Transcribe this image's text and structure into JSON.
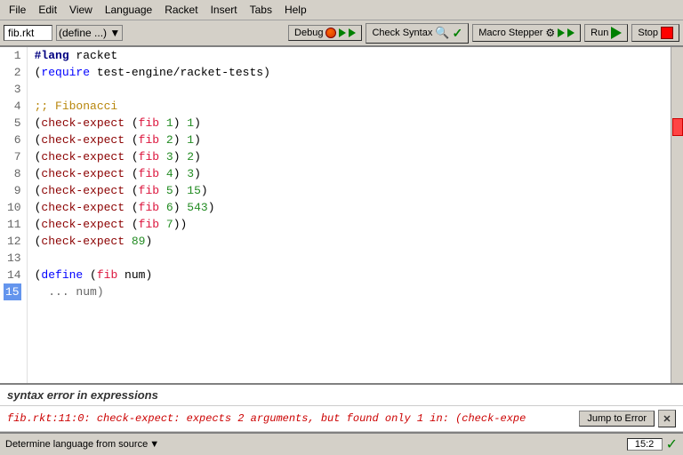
{
  "menubar": {
    "items": [
      "File",
      "Edit",
      "View",
      "Language",
      "Racket",
      "Insert",
      "Tabs",
      "Help"
    ]
  },
  "toolbar": {
    "filename": "fib.rkt",
    "dropdown_label": "(define ...) ▼",
    "debug_label": "Debug",
    "check_syntax_label": "Check Syntax",
    "macro_stepper_label": "Macro Stepper",
    "run_label": "Run",
    "stop_label": "Stop"
  },
  "editor": {
    "lines": [
      {
        "num": 1,
        "current": false,
        "tokens": [
          {
            "text": "#lang",
            "cls": "kw"
          },
          {
            "text": " racket",
            "cls": ""
          }
        ]
      },
      {
        "num": 2,
        "current": false,
        "tokens": [
          {
            "text": "(",
            "cls": "paren"
          },
          {
            "text": "require",
            "cls": "kw2"
          },
          {
            "text": " test-engine/racket-tests",
            "cls": ""
          },
          {
            "text": ")",
            "cls": "paren"
          }
        ]
      },
      {
        "num": 3,
        "current": false,
        "tokens": []
      },
      {
        "num": 4,
        "current": false,
        "tokens": [
          {
            "text": ";; Fibonacci",
            "cls": "comment"
          }
        ]
      },
      {
        "num": 5,
        "current": false,
        "tokens": [
          {
            "text": "(",
            "cls": ""
          },
          {
            "text": "check-expect",
            "cls": "fn"
          },
          {
            "text": " (",
            "cls": ""
          },
          {
            "text": "fib",
            "cls": "fn2"
          },
          {
            "text": " ",
            "cls": ""
          },
          {
            "text": "1",
            "cls": "num"
          },
          {
            "text": ") ",
            "cls": ""
          },
          {
            "text": "1",
            "cls": "num"
          },
          {
            "text": ")",
            "cls": ""
          }
        ]
      },
      {
        "num": 6,
        "current": false,
        "tokens": [
          {
            "text": "(",
            "cls": ""
          },
          {
            "text": "check-expect",
            "cls": "fn"
          },
          {
            "text": " (",
            "cls": ""
          },
          {
            "text": "fib",
            "cls": "fn2"
          },
          {
            "text": " ",
            "cls": ""
          },
          {
            "text": "2",
            "cls": "num"
          },
          {
            "text": ") ",
            "cls": ""
          },
          {
            "text": "1",
            "cls": "num"
          },
          {
            "text": ")",
            "cls": ""
          }
        ]
      },
      {
        "num": 7,
        "current": false,
        "tokens": [
          {
            "text": "(",
            "cls": ""
          },
          {
            "text": "check-expect",
            "cls": "fn"
          },
          {
            "text": " (",
            "cls": ""
          },
          {
            "text": "fib",
            "cls": "fn2"
          },
          {
            "text": " ",
            "cls": ""
          },
          {
            "text": "3",
            "cls": "num"
          },
          {
            "text": ") ",
            "cls": ""
          },
          {
            "text": "2",
            "cls": "num"
          },
          {
            "text": ")",
            "cls": ""
          }
        ]
      },
      {
        "num": 8,
        "current": false,
        "tokens": [
          {
            "text": "(",
            "cls": ""
          },
          {
            "text": "check-expect",
            "cls": "fn"
          },
          {
            "text": " (",
            "cls": ""
          },
          {
            "text": "fib",
            "cls": "fn2"
          },
          {
            "text": " ",
            "cls": ""
          },
          {
            "text": "4",
            "cls": "num"
          },
          {
            "text": ") ",
            "cls": ""
          },
          {
            "text": "3",
            "cls": "num"
          },
          {
            "text": ")",
            "cls": ""
          }
        ]
      },
      {
        "num": 9,
        "current": false,
        "tokens": [
          {
            "text": "(",
            "cls": ""
          },
          {
            "text": "check-expect",
            "cls": "fn"
          },
          {
            "text": " (",
            "cls": ""
          },
          {
            "text": "fib",
            "cls": "fn2"
          },
          {
            "text": " ",
            "cls": ""
          },
          {
            "text": "5",
            "cls": "num"
          },
          {
            "text": ") ",
            "cls": ""
          },
          {
            "text": "15",
            "cls": "num"
          },
          {
            "text": ")",
            "cls": ""
          }
        ]
      },
      {
        "num": 10,
        "current": false,
        "tokens": [
          {
            "text": "(",
            "cls": ""
          },
          {
            "text": "check-expect",
            "cls": "fn"
          },
          {
            "text": " (",
            "cls": ""
          },
          {
            "text": "fib",
            "cls": "fn2"
          },
          {
            "text": " ",
            "cls": ""
          },
          {
            "text": "6",
            "cls": "num"
          },
          {
            "text": ") ",
            "cls": ""
          },
          {
            "text": "543",
            "cls": "num"
          },
          {
            "text": ")",
            "cls": ""
          }
        ]
      },
      {
        "num": 11,
        "current": false,
        "tokens": [
          {
            "text": "(",
            "cls": ""
          },
          {
            "text": "check-expect",
            "cls": "fn"
          },
          {
            "text": " (",
            "cls": ""
          },
          {
            "text": "fib",
            "cls": "fn2"
          },
          {
            "text": " ",
            "cls": ""
          },
          {
            "text": "7",
            "cls": "num"
          },
          {
            "text": "))",
            "cls": ""
          }
        ]
      },
      {
        "num": 12,
        "current": false,
        "tokens": [
          {
            "text": "(",
            "cls": ""
          },
          {
            "text": "check-expect",
            "cls": "fn"
          },
          {
            "text": " ",
            "cls": ""
          },
          {
            "text": "89",
            "cls": "num"
          },
          {
            "text": ")",
            "cls": ""
          }
        ]
      },
      {
        "num": 13,
        "current": false,
        "tokens": []
      },
      {
        "num": 14,
        "current": false,
        "tokens": [
          {
            "text": "(",
            "cls": ""
          },
          {
            "text": "define",
            "cls": "kw2"
          },
          {
            "text": " (",
            "cls": ""
          },
          {
            "text": "fib",
            "cls": "fn2"
          },
          {
            "text": " num)",
            "cls": ""
          }
        ]
      },
      {
        "num": 15,
        "current": true,
        "tokens": [
          {
            "text": "  ... num)",
            "cls": "ellipsis"
          }
        ]
      }
    ]
  },
  "error": {
    "header": "syntax error in expressions",
    "message": "fib.rkt:11:0: check-expect: expects 2 arguments, but found only 1 in: (check-expe",
    "jump_button": "Jump to Error",
    "close_icon": "✕"
  },
  "statusbar": {
    "language_label": "Determine language from source",
    "position": "15:2",
    "dropdown_arrow": "▼"
  }
}
